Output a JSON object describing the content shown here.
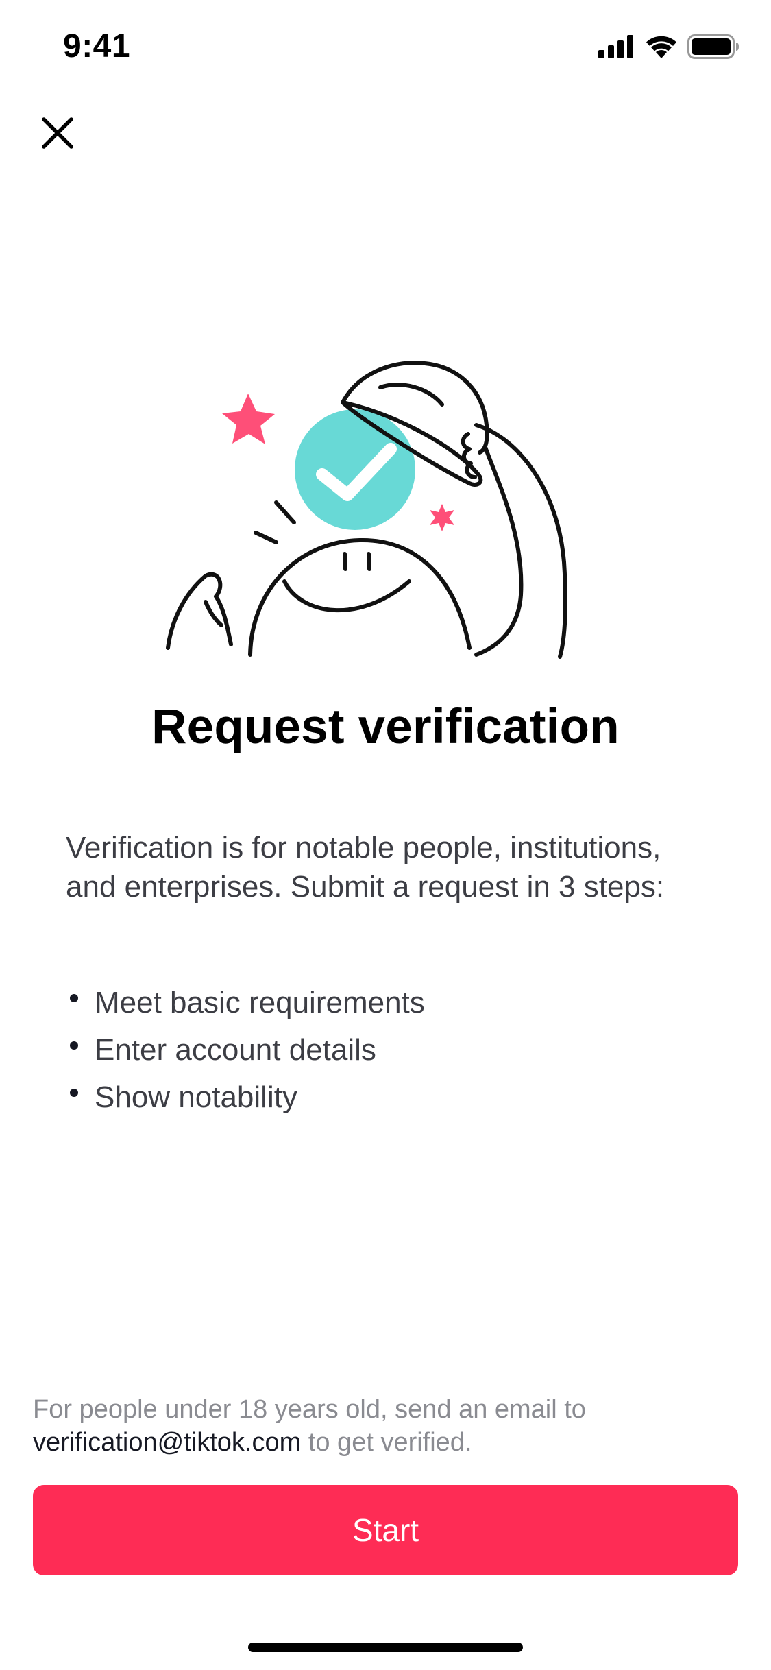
{
  "status_bar": {
    "time": "9:41",
    "icons": [
      "cellular-signal-icon",
      "wifi-icon",
      "battery-icon"
    ]
  },
  "close_icon": "close-icon",
  "illustration": "verification-illustration",
  "title": "Request verification",
  "description": "Verification is for notable people, institutions, and enterprises. Submit a request in 3 steps:",
  "steps": [
    "Meet basic requirements",
    "Enter account details",
    "Show notability"
  ],
  "footer": {
    "prefix": "For people under 18 years old, send an email to ",
    "email": "verification@tiktok.com",
    "suffix": " to get verified."
  },
  "start_button_label": "Start",
  "colors": {
    "accent": "#fe2c55",
    "badge": "#68d9d6",
    "star": "#fe4f78"
  }
}
